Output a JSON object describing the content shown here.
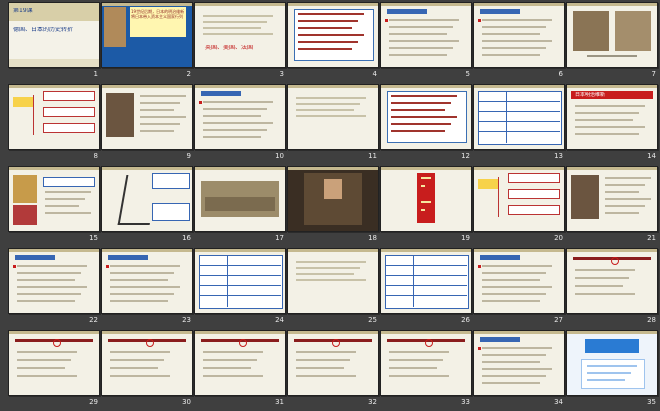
{
  "grid": {
    "columns": 7,
    "rows": 5,
    "background": "#3f3f3f"
  },
  "slides": [
    {
      "num": "1",
      "variant": "title",
      "badge": "第19课",
      "heading": "德国、日本的历史转折"
    },
    {
      "num": "2",
      "variant": "portrait",
      "caption": "19世纪后期，日本的明治维新将日本带入资本主义国家行列"
    },
    {
      "num": "3",
      "variant": "text",
      "lines": [
        "英国、美国、法国"
      ]
    },
    {
      "num": "4",
      "variant": "textbox",
      "lines": []
    },
    {
      "num": "5",
      "variant": "list",
      "lines": []
    },
    {
      "num": "6",
      "variant": "list",
      "lines": []
    },
    {
      "num": "7",
      "variant": "photo",
      "lines": []
    },
    {
      "num": "8",
      "variant": "diagram",
      "lines": []
    },
    {
      "num": "9",
      "variant": "portrait-side",
      "lines": []
    },
    {
      "num": "10",
      "variant": "list",
      "lines": []
    },
    {
      "num": "11",
      "variant": "text",
      "lines": []
    },
    {
      "num": "12",
      "variant": "textbox",
      "lines": []
    },
    {
      "num": "13",
      "variant": "table",
      "lines": []
    },
    {
      "num": "14",
      "variant": "list-header",
      "heading": "日本明治维新",
      "lines": []
    },
    {
      "num": "15",
      "variant": "figures",
      "lines": []
    },
    {
      "num": "16",
      "variant": "map",
      "lines": []
    },
    {
      "num": "17",
      "variant": "painting",
      "lines": []
    },
    {
      "num": "18",
      "variant": "portrait-center",
      "lines": []
    },
    {
      "num": "19",
      "variant": "vertical",
      "lines": []
    },
    {
      "num": "20",
      "variant": "diagram",
      "lines": []
    },
    {
      "num": "21",
      "variant": "portrait-side",
      "lines": []
    },
    {
      "num": "22",
      "variant": "list",
      "lines": []
    },
    {
      "num": "23",
      "variant": "list",
      "lines": []
    },
    {
      "num": "24",
      "variant": "table",
      "lines": []
    },
    {
      "num": "25",
      "variant": "text",
      "lines": []
    },
    {
      "num": "26",
      "variant": "table",
      "lines": []
    },
    {
      "num": "27",
      "variant": "list",
      "lines": []
    },
    {
      "num": "28",
      "variant": "quiz",
      "lines": []
    },
    {
      "num": "29",
      "variant": "quiz",
      "lines": []
    },
    {
      "num": "30",
      "variant": "quiz",
      "lines": []
    },
    {
      "num": "31",
      "variant": "quiz",
      "lines": []
    },
    {
      "num": "32",
      "variant": "quiz",
      "lines": []
    },
    {
      "num": "33",
      "variant": "quiz",
      "lines": []
    },
    {
      "num": "34",
      "variant": "list",
      "lines": []
    },
    {
      "num": "35",
      "variant": "brand",
      "lines": []
    }
  ]
}
